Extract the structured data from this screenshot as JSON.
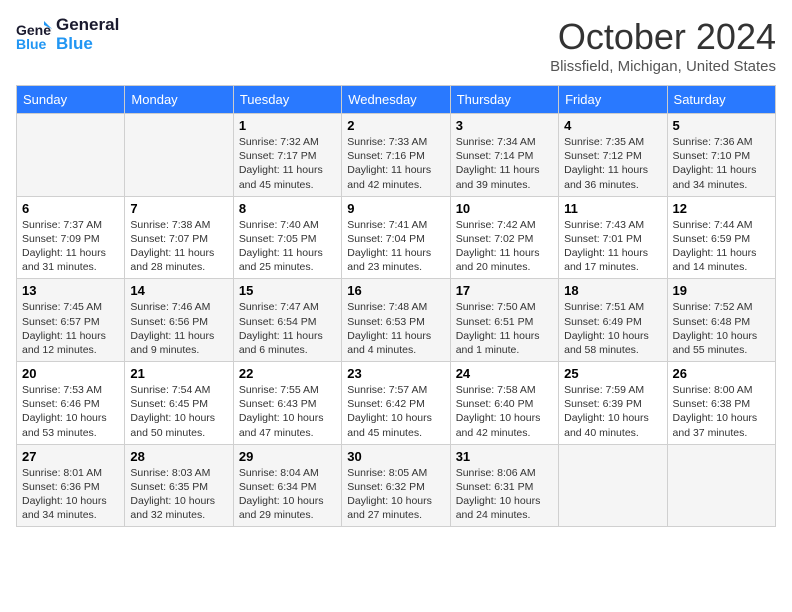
{
  "logo": {
    "line1": "General",
    "line2": "Blue"
  },
  "title": "October 2024",
  "location": "Blissfield, Michigan, United States",
  "weekdays": [
    "Sunday",
    "Monday",
    "Tuesday",
    "Wednesday",
    "Thursday",
    "Friday",
    "Saturday"
  ],
  "weeks": [
    [
      {
        "num": "",
        "sunrise": "",
        "sunset": "",
        "daylight": ""
      },
      {
        "num": "",
        "sunrise": "",
        "sunset": "",
        "daylight": ""
      },
      {
        "num": "1",
        "sunrise": "Sunrise: 7:32 AM",
        "sunset": "Sunset: 7:17 PM",
        "daylight": "Daylight: 11 hours and 45 minutes."
      },
      {
        "num": "2",
        "sunrise": "Sunrise: 7:33 AM",
        "sunset": "Sunset: 7:16 PM",
        "daylight": "Daylight: 11 hours and 42 minutes."
      },
      {
        "num": "3",
        "sunrise": "Sunrise: 7:34 AM",
        "sunset": "Sunset: 7:14 PM",
        "daylight": "Daylight: 11 hours and 39 minutes."
      },
      {
        "num": "4",
        "sunrise": "Sunrise: 7:35 AM",
        "sunset": "Sunset: 7:12 PM",
        "daylight": "Daylight: 11 hours and 36 minutes."
      },
      {
        "num": "5",
        "sunrise": "Sunrise: 7:36 AM",
        "sunset": "Sunset: 7:10 PM",
        "daylight": "Daylight: 11 hours and 34 minutes."
      }
    ],
    [
      {
        "num": "6",
        "sunrise": "Sunrise: 7:37 AM",
        "sunset": "Sunset: 7:09 PM",
        "daylight": "Daylight: 11 hours and 31 minutes."
      },
      {
        "num": "7",
        "sunrise": "Sunrise: 7:38 AM",
        "sunset": "Sunset: 7:07 PM",
        "daylight": "Daylight: 11 hours and 28 minutes."
      },
      {
        "num": "8",
        "sunrise": "Sunrise: 7:40 AM",
        "sunset": "Sunset: 7:05 PM",
        "daylight": "Daylight: 11 hours and 25 minutes."
      },
      {
        "num": "9",
        "sunrise": "Sunrise: 7:41 AM",
        "sunset": "Sunset: 7:04 PM",
        "daylight": "Daylight: 11 hours and 23 minutes."
      },
      {
        "num": "10",
        "sunrise": "Sunrise: 7:42 AM",
        "sunset": "Sunset: 7:02 PM",
        "daylight": "Daylight: 11 hours and 20 minutes."
      },
      {
        "num": "11",
        "sunrise": "Sunrise: 7:43 AM",
        "sunset": "Sunset: 7:01 PM",
        "daylight": "Daylight: 11 hours and 17 minutes."
      },
      {
        "num": "12",
        "sunrise": "Sunrise: 7:44 AM",
        "sunset": "Sunset: 6:59 PM",
        "daylight": "Daylight: 11 hours and 14 minutes."
      }
    ],
    [
      {
        "num": "13",
        "sunrise": "Sunrise: 7:45 AM",
        "sunset": "Sunset: 6:57 PM",
        "daylight": "Daylight: 11 hours and 12 minutes."
      },
      {
        "num": "14",
        "sunrise": "Sunrise: 7:46 AM",
        "sunset": "Sunset: 6:56 PM",
        "daylight": "Daylight: 11 hours and 9 minutes."
      },
      {
        "num": "15",
        "sunrise": "Sunrise: 7:47 AM",
        "sunset": "Sunset: 6:54 PM",
        "daylight": "Daylight: 11 hours and 6 minutes."
      },
      {
        "num": "16",
        "sunrise": "Sunrise: 7:48 AM",
        "sunset": "Sunset: 6:53 PM",
        "daylight": "Daylight: 11 hours and 4 minutes."
      },
      {
        "num": "17",
        "sunrise": "Sunrise: 7:50 AM",
        "sunset": "Sunset: 6:51 PM",
        "daylight": "Daylight: 11 hours and 1 minute."
      },
      {
        "num": "18",
        "sunrise": "Sunrise: 7:51 AM",
        "sunset": "Sunset: 6:49 PM",
        "daylight": "Daylight: 10 hours and 58 minutes."
      },
      {
        "num": "19",
        "sunrise": "Sunrise: 7:52 AM",
        "sunset": "Sunset: 6:48 PM",
        "daylight": "Daylight: 10 hours and 55 minutes."
      }
    ],
    [
      {
        "num": "20",
        "sunrise": "Sunrise: 7:53 AM",
        "sunset": "Sunset: 6:46 PM",
        "daylight": "Daylight: 10 hours and 53 minutes."
      },
      {
        "num": "21",
        "sunrise": "Sunrise: 7:54 AM",
        "sunset": "Sunset: 6:45 PM",
        "daylight": "Daylight: 10 hours and 50 minutes."
      },
      {
        "num": "22",
        "sunrise": "Sunrise: 7:55 AM",
        "sunset": "Sunset: 6:43 PM",
        "daylight": "Daylight: 10 hours and 47 minutes."
      },
      {
        "num": "23",
        "sunrise": "Sunrise: 7:57 AM",
        "sunset": "Sunset: 6:42 PM",
        "daylight": "Daylight: 10 hours and 45 minutes."
      },
      {
        "num": "24",
        "sunrise": "Sunrise: 7:58 AM",
        "sunset": "Sunset: 6:40 PM",
        "daylight": "Daylight: 10 hours and 42 minutes."
      },
      {
        "num": "25",
        "sunrise": "Sunrise: 7:59 AM",
        "sunset": "Sunset: 6:39 PM",
        "daylight": "Daylight: 10 hours and 40 minutes."
      },
      {
        "num": "26",
        "sunrise": "Sunrise: 8:00 AM",
        "sunset": "Sunset: 6:38 PM",
        "daylight": "Daylight: 10 hours and 37 minutes."
      }
    ],
    [
      {
        "num": "27",
        "sunrise": "Sunrise: 8:01 AM",
        "sunset": "Sunset: 6:36 PM",
        "daylight": "Daylight: 10 hours and 34 minutes."
      },
      {
        "num": "28",
        "sunrise": "Sunrise: 8:03 AM",
        "sunset": "Sunset: 6:35 PM",
        "daylight": "Daylight: 10 hours and 32 minutes."
      },
      {
        "num": "29",
        "sunrise": "Sunrise: 8:04 AM",
        "sunset": "Sunset: 6:34 PM",
        "daylight": "Daylight: 10 hours and 29 minutes."
      },
      {
        "num": "30",
        "sunrise": "Sunrise: 8:05 AM",
        "sunset": "Sunset: 6:32 PM",
        "daylight": "Daylight: 10 hours and 27 minutes."
      },
      {
        "num": "31",
        "sunrise": "Sunrise: 8:06 AM",
        "sunset": "Sunset: 6:31 PM",
        "daylight": "Daylight: 10 hours and 24 minutes."
      },
      {
        "num": "",
        "sunrise": "",
        "sunset": "",
        "daylight": ""
      },
      {
        "num": "",
        "sunrise": "",
        "sunset": "",
        "daylight": ""
      }
    ]
  ]
}
